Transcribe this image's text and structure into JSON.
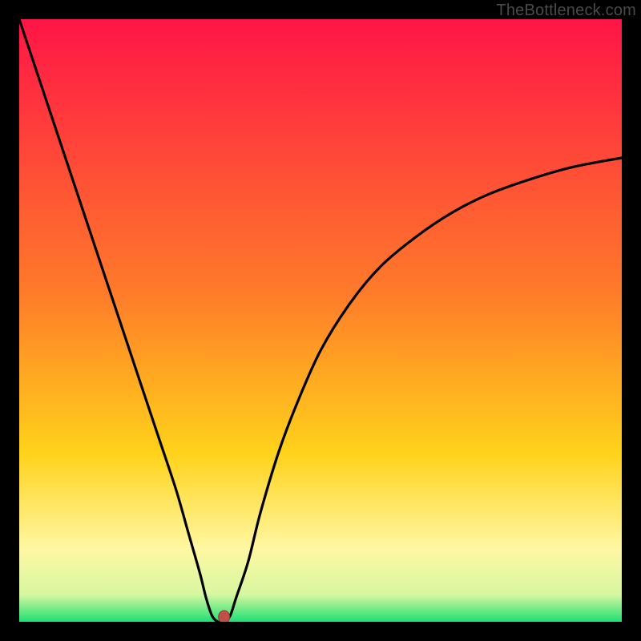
{
  "watermark": "TheBottleneck.com",
  "colors": {
    "bg": "#000000",
    "grad_top": "#ff1546",
    "grad_mid": "#ffd21a",
    "grad_low": "#fff7a3",
    "grad_bottom": "#1fe074",
    "curve": "#000000",
    "marker_fill": "#c05048",
    "marker_stroke": "#8a3a34"
  },
  "chart_data": {
    "type": "line",
    "title": "",
    "xlabel": "",
    "ylabel": "",
    "xlim": [
      0,
      100
    ],
    "ylim": [
      0,
      100
    ],
    "series": [
      {
        "name": "bottleneck-curve",
        "x": [
          0,
          2,
          5,
          8,
          11,
          14,
          17,
          20,
          23,
          26,
          28,
          30,
          31,
          32,
          33,
          34,
          35,
          36,
          38,
          40,
          43,
          46,
          50,
          55,
          60,
          66,
          72,
          78,
          85,
          92,
          100
        ],
        "values": [
          100,
          94,
          85,
          76,
          67,
          58,
          49,
          40,
          31,
          22,
          15,
          8,
          4,
          1,
          0,
          0,
          1,
          4,
          10,
          18,
          28,
          36,
          45,
          53,
          59,
          64,
          68,
          71,
          73.5,
          75.5,
          77
        ]
      }
    ],
    "marker": {
      "x": 34,
      "y": 0
    },
    "gradient_stops": [
      {
        "pos": 0.0,
        "color": "#ff1546"
      },
      {
        "pos": 0.45,
        "color": "#ff7a2a"
      },
      {
        "pos": 0.72,
        "color": "#ffd21a"
      },
      {
        "pos": 0.88,
        "color": "#fff7a3"
      },
      {
        "pos": 0.955,
        "color": "#d6f7a0"
      },
      {
        "pos": 1.0,
        "color": "#1fe074"
      }
    ]
  }
}
